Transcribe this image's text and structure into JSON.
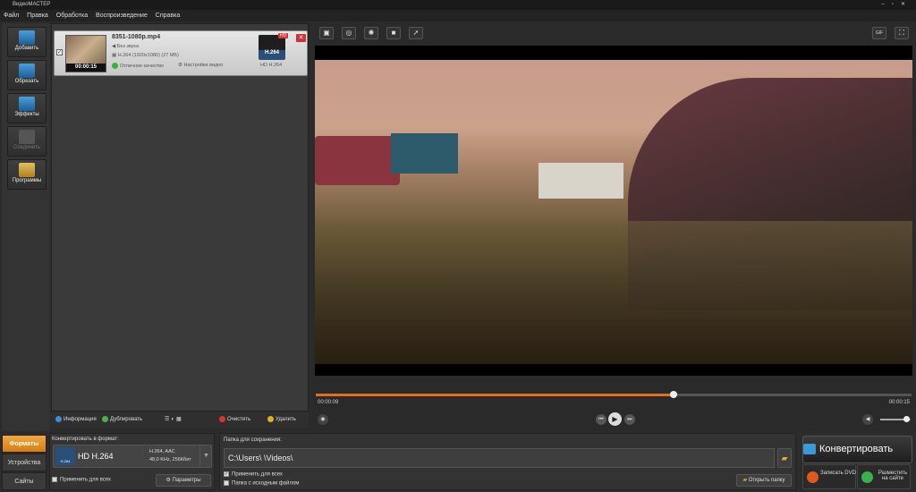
{
  "window": {
    "title": "ВидеоМАСТЕР"
  },
  "menu": [
    "Файл",
    "Правка",
    "Обработка",
    "Воспроизведение",
    "Справка"
  ],
  "sidebar": {
    "items": [
      {
        "label": "Добавить",
        "icon": "add-video-icon",
        "enabled": true
      },
      {
        "label": "Обрезать",
        "icon": "cut-icon",
        "enabled": true
      },
      {
        "label": "Эффекты",
        "icon": "effects-icon",
        "enabled": true
      },
      {
        "label": "Соединить",
        "icon": "join-icon",
        "enabled": false
      },
      {
        "label": "Программы",
        "icon": "programs-icon",
        "enabled": true
      }
    ]
  },
  "file": {
    "name": "8351-1080p.mp4",
    "duration": "00:00:15",
    "audio": "Без звука",
    "video_info": "H.264 (1920x1080) (27 МБ)",
    "quality": "Отличное качество",
    "settings": "Настройки видео",
    "format_badge": "H.264",
    "format_label": "HD H.264",
    "hd_tag": "HD"
  },
  "filetools": {
    "info": "Информация",
    "duplicate": "Дублировать",
    "clear": "Очистить",
    "delete": "Удалить"
  },
  "player": {
    "current_time": "00:00:09",
    "total_time": "00:00:15",
    "progress": 0.6,
    "volume": 0.85,
    "gif_label": "GIF"
  },
  "tabs": [
    "Форматы",
    "Устройства",
    "Сайты"
  ],
  "format": {
    "heading": "Конвертировать в формат:",
    "name": "HD H.264",
    "codec": "H.264, AAC",
    "audio": "48,0 KHz, 256Кбит",
    "apply_all": "Применить для всех",
    "params": "Параметры",
    "badge": "H.264"
  },
  "save": {
    "heading": "Папка для сохранения:",
    "path": "C:\\Users\\          \\Videos\\",
    "apply_all": "Применить для всех",
    "source_folder": "Папка с исходным файлом",
    "open_folder": "Открыть папку"
  },
  "actions": {
    "convert": "Конвертировать",
    "burn_dvd": "Записать DVD",
    "publish": "Разместить на сайте"
  },
  "colors": {
    "accent": "#e07020",
    "format_badge": "#2a4f78"
  }
}
